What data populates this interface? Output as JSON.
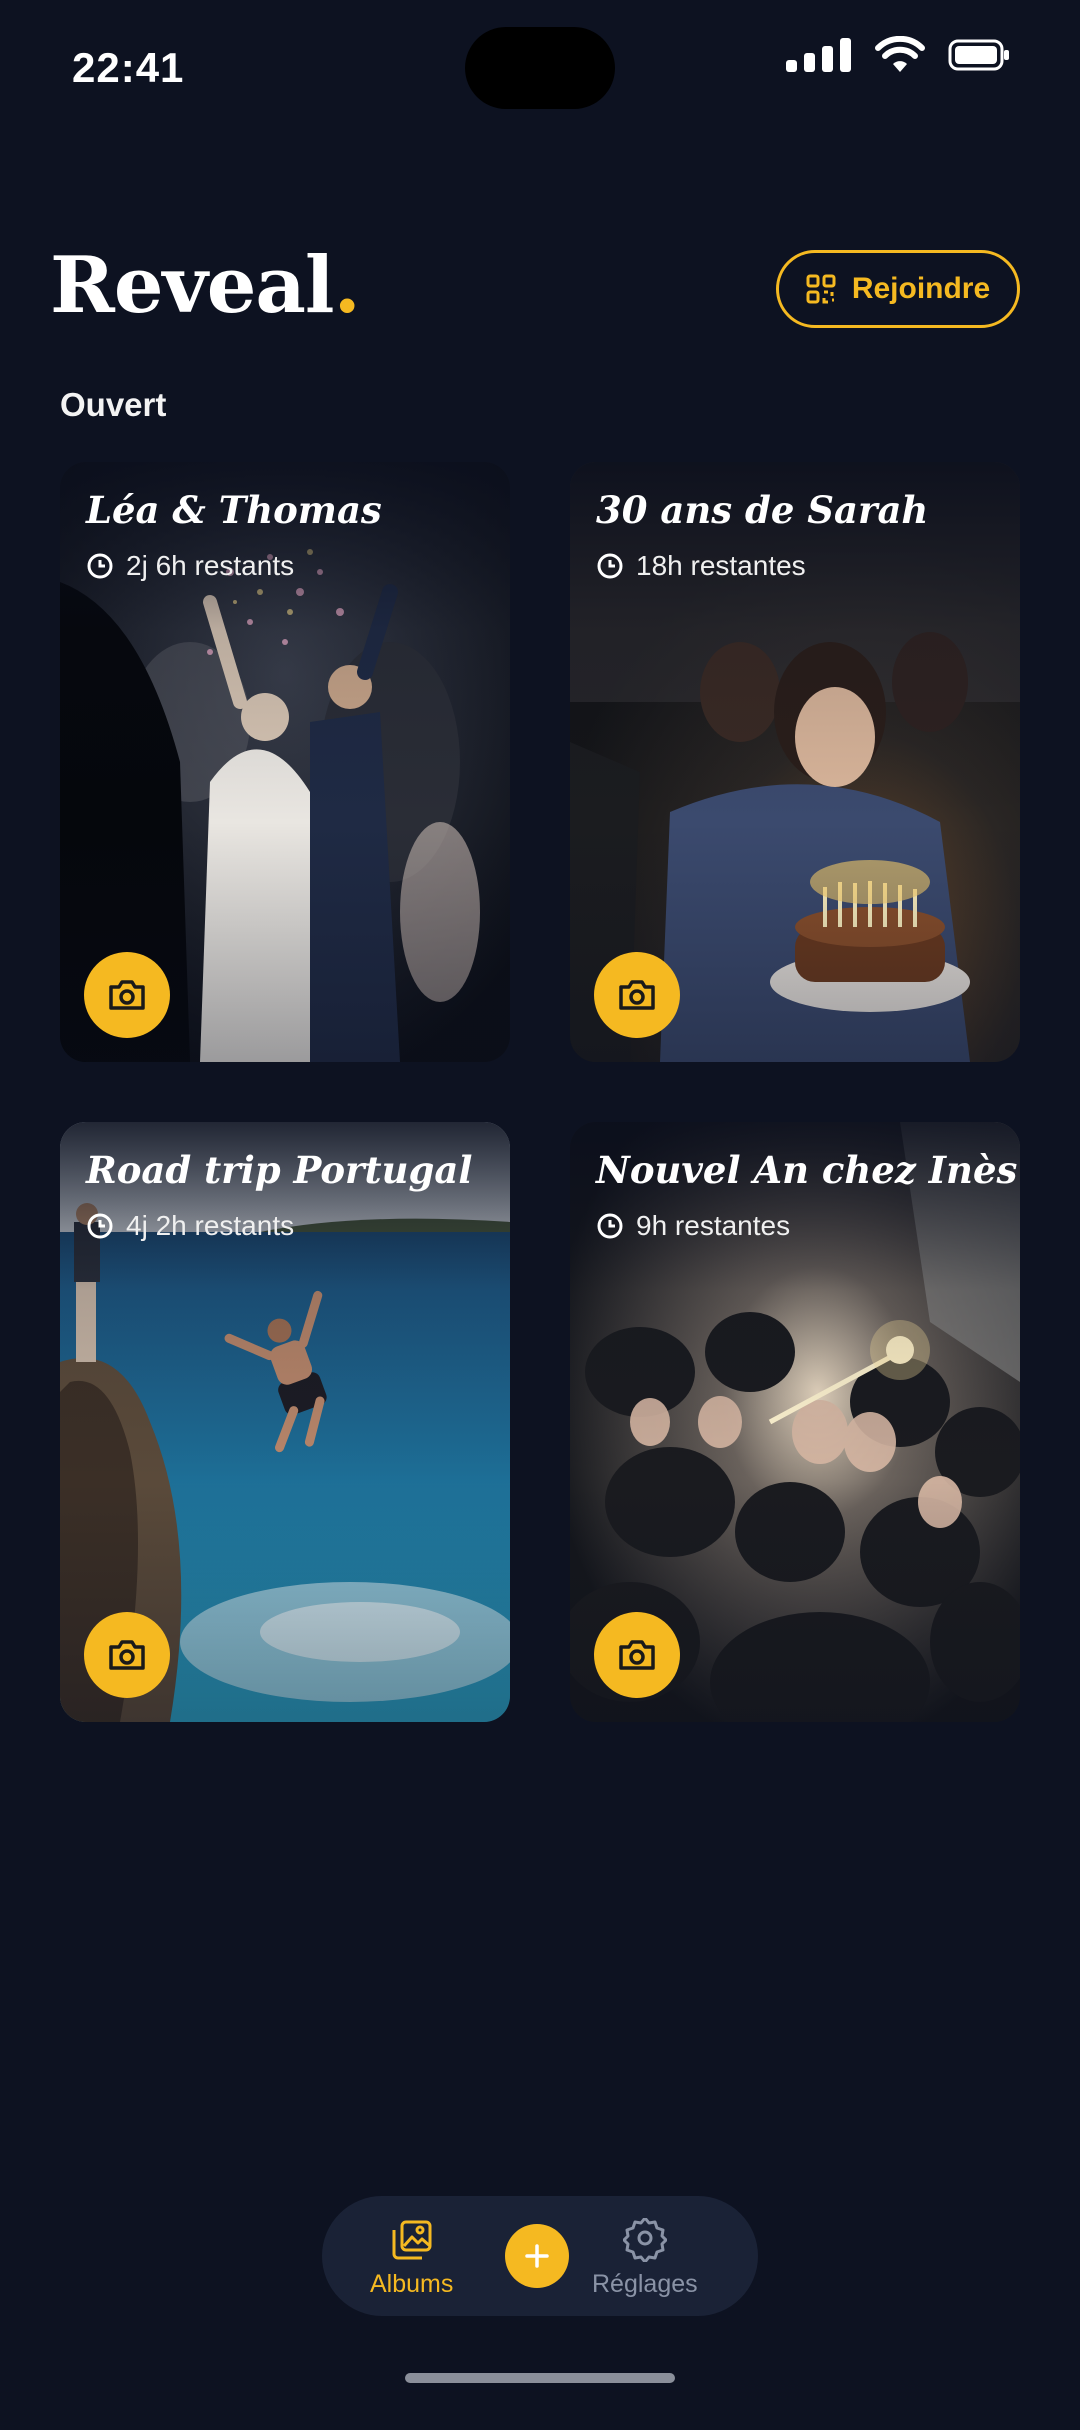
{
  "status_bar": {
    "time": "22:41"
  },
  "header": {
    "logo_text": "Reveal",
    "logo_dot": ".",
    "join_label": "Rejoindre"
  },
  "section": {
    "label": "Ouvert"
  },
  "albums": [
    {
      "title": "Léa & Thomas",
      "time_left": "2j 6h restants",
      "photo": "wedding-exit-confetti"
    },
    {
      "title": "30 ans de Sarah",
      "time_left": "18h restantes",
      "photo": "birthday-cake-candles"
    },
    {
      "title": "Road trip Portugal",
      "time_left": "4j 2h restants",
      "photo": "cliff-jump-sea"
    },
    {
      "title": "Nouvel An chez Inès",
      "time_left": "9h restantes",
      "photo": "party-crowd-sparkler"
    }
  ],
  "tabbar": {
    "albums_label": "Albums",
    "settings_label": "Réglages",
    "active_tab": "Albums"
  },
  "colors": {
    "background": "#0d1221",
    "accent": "#f5b921",
    "tabbar": "#1a2236",
    "inactive": "#8a93a6"
  }
}
